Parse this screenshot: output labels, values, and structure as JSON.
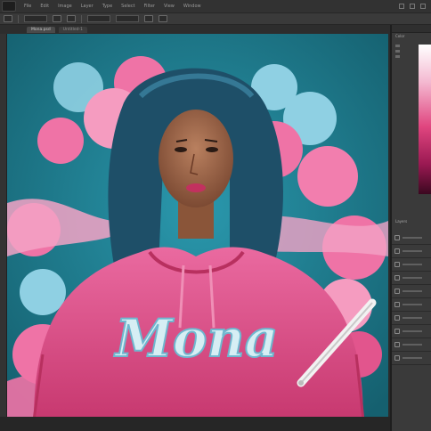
{
  "menubar": {
    "items": [
      "File",
      "Edit",
      "Image",
      "Layer",
      "Type",
      "Select",
      "Filter",
      "View",
      "Window"
    ]
  },
  "tabs": [
    {
      "label": "Mona.psd",
      "active": true
    },
    {
      "label": "Untitled-1",
      "active": false
    }
  ],
  "canvas": {
    "hoodie_text": "Mona",
    "colors": {
      "background": "#1f7f93",
      "hoodie": "#e2558d",
      "smoke_pink": "#ef73a6",
      "smoke_blue": "#8fd0e3",
      "lettering": "#d6eef4",
      "hair": "#1e4f68"
    }
  },
  "panels": {
    "color_title": "Color",
    "layers_title": "Layers",
    "swatch_colors": [
      "#ffffff",
      "#f4b9d1",
      "#e0457f",
      "#9a1952",
      "#3b0820"
    ]
  },
  "icons": [
    "ps-logo-icon",
    "minimize-icon",
    "maximize-icon",
    "close-icon",
    "layer-visibility-icon"
  ]
}
